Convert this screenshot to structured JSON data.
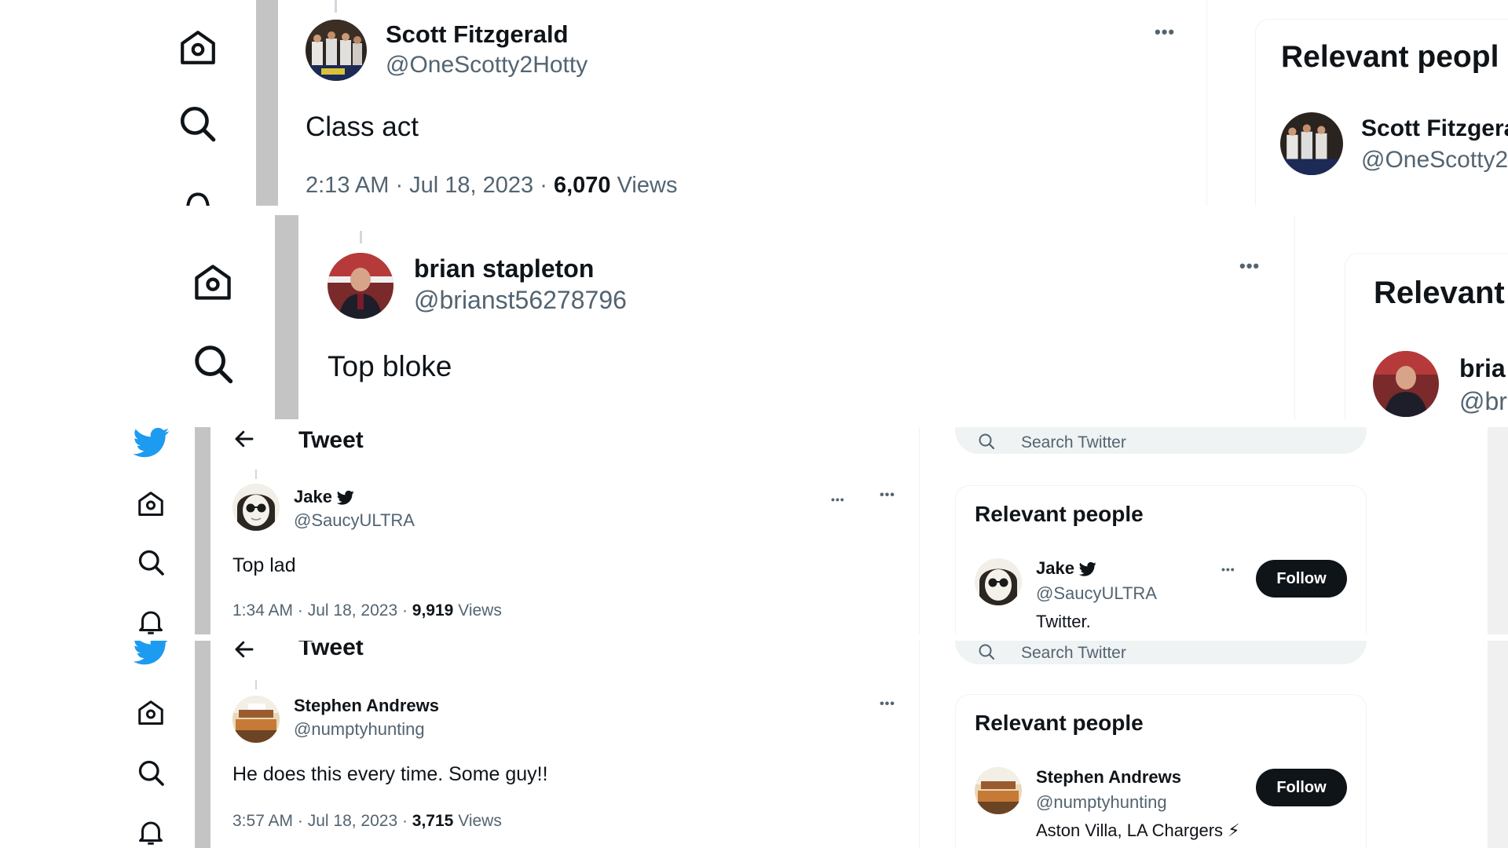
{
  "panel1": {
    "name": "Scott Fitzgerald",
    "handle": "@OneScotty2Hotty",
    "text": "Class act",
    "time": "2:13 AM · Jul 18, 2023 · ",
    "views_count": "6,070",
    "views_label": "Views",
    "more": "•••",
    "side_title": "Relevant peopl",
    "side_name": "Scott Fitzgera",
    "side_handle": "@OneScotty2"
  },
  "panel2": {
    "name": "brian stapleton",
    "handle": "@brianst56278796",
    "text": "Top bloke",
    "more": "•••",
    "side_title": "Relevant",
    "side_name": "bria",
    "side_handle": "@bri"
  },
  "panel3": {
    "header": "Tweet",
    "name": "Jake",
    "handle": "@SaucyULTRA",
    "text": "Top lad",
    "time": "1:34 AM · Jul 18, 2023 · ",
    "views_count": "9,919",
    "views_label": "Views",
    "more": "•••",
    "search_placeholder": "Search Twitter",
    "side_title": "Relevant people",
    "side_name": "Jake",
    "side_handle": "@SaucyULTRA",
    "side_bio": "Twitter.",
    "follow": "Follow"
  },
  "panel4": {
    "header": "Tweet",
    "name": "Stephen Andrews",
    "handle": "@numptyhunting",
    "text": "He does this every time. Some guy!!",
    "time": "3:57 AM · Jul 18, 2023 · ",
    "views_count": "3,715",
    "views_label": "Views",
    "more": "•••",
    "search_placeholder": "Search Twitter",
    "side_title": "Relevant people",
    "side_name": "Stephen Andrews",
    "side_handle": "@numptyhunting",
    "side_bio": "Aston Villa, LA Chargers ⚡",
    "follow": "Follow"
  },
  "colors": {
    "twitter_blue": "#1d9bf0",
    "text_primary": "#0f1419",
    "text_secondary": "#536471",
    "gray_bar": "#c4c4c4"
  }
}
